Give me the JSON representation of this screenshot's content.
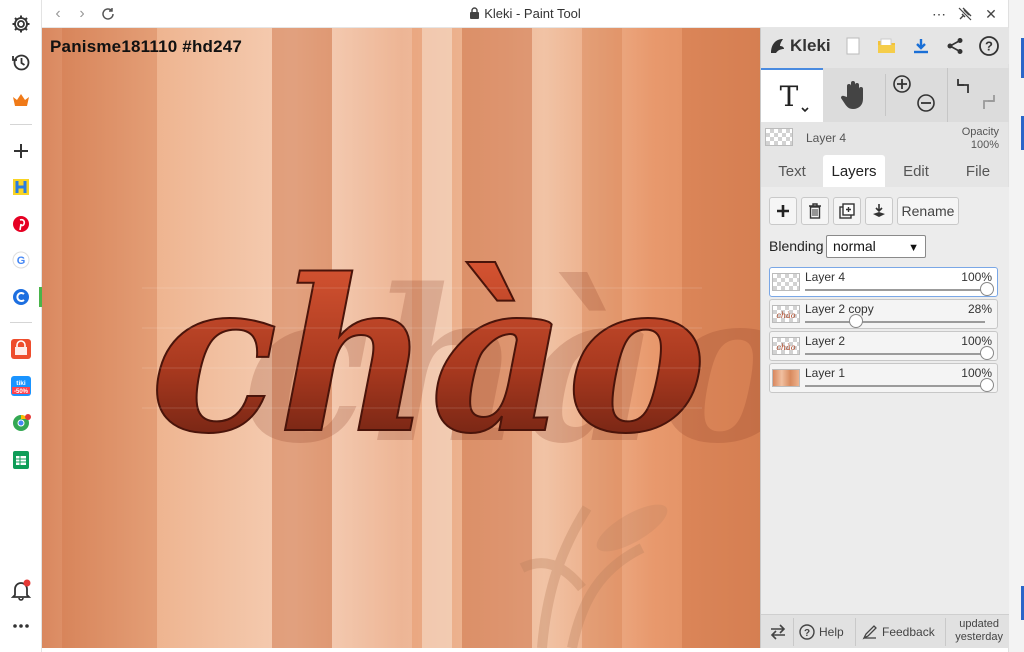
{
  "window": {
    "title": "Kleki - Paint Tool"
  },
  "canvas": {
    "label": "Panisme181110 #hd247",
    "art_text": "chào"
  },
  "app": {
    "logo_text": "Kleki"
  },
  "current_layer": {
    "name": "Layer 4",
    "opacity_label": "Opacity",
    "opacity_value": "100%"
  },
  "tabs": [
    {
      "label": "Text"
    },
    {
      "label": "Layers"
    },
    {
      "label": "Edit"
    },
    {
      "label": "File"
    }
  ],
  "active_tab": "Layers",
  "layer_actions": {
    "rename_label": "Rename"
  },
  "blending": {
    "label": "Blending",
    "value": "normal"
  },
  "layers": [
    {
      "name": "Layer 4",
      "opacity": "100%",
      "opacity_fraction": 1.0,
      "active": true
    },
    {
      "name": "Layer 2 copy",
      "opacity": "28%",
      "opacity_fraction": 0.28,
      "active": false
    },
    {
      "name": "Layer 2",
      "opacity": "100%",
      "opacity_fraction": 1.0,
      "active": false
    },
    {
      "name": "Layer 1",
      "opacity": "100%",
      "opacity_fraction": 1.0,
      "active": false
    }
  ],
  "footer": {
    "help_label": "Help",
    "feedback_label": "Feedback",
    "updated_line1": "updated",
    "updated_line2": "yesterday"
  },
  "colors": {
    "accent": "#4a8be0",
    "art_red": "#c9442a",
    "art_dark": "#6b1f12",
    "curtain": "#e8a27a"
  },
  "icons": {
    "sidebar": [
      "gear-icon",
      "history-icon",
      "crown-icon",
      "plus-icon",
      "h-app-icon",
      "pinterest-icon",
      "google-icon",
      "blue-app-icon",
      "shopee-icon",
      "tiki-icon",
      "chrome-store-icon",
      "sheets-icon",
      "bell-icon",
      "more-icon"
    ],
    "toolbar": [
      "new-image-icon",
      "open-folder-icon",
      "download-icon",
      "share-icon",
      "help-circle-icon"
    ]
  }
}
